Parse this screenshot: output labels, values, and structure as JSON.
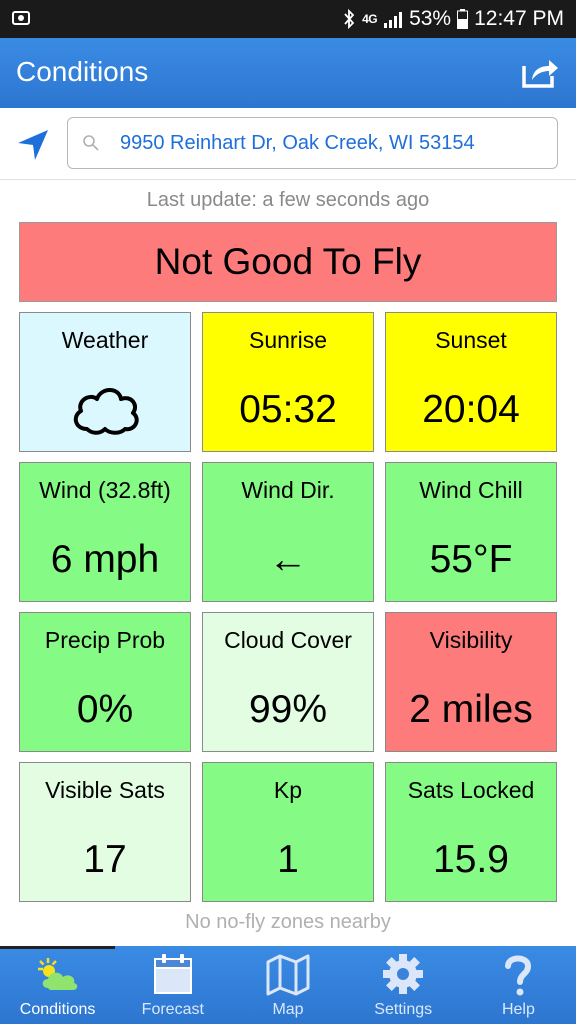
{
  "status_bar": {
    "network": "4G",
    "battery": "53%",
    "time": "12:47 PM"
  },
  "app_bar": {
    "title": "Conditions"
  },
  "search": {
    "address": "9950 Reinhart Dr, Oak Creek, WI 53154"
  },
  "last_update": "Last update: a few seconds ago",
  "verdict": "Not Good To Fly",
  "tiles": [
    {
      "label": "Weather",
      "value": "",
      "icon": "cloud-icon",
      "color": "#dcf8ff"
    },
    {
      "label": "Sunrise",
      "value": "05:32",
      "color": "#ffff00"
    },
    {
      "label": "Sunset",
      "value": "20:04",
      "color": "#ffff00"
    },
    {
      "label": "Wind (32.8ft)",
      "value": "6 mph",
      "color": "#85fb85"
    },
    {
      "label": "Wind Dir.",
      "value": "←",
      "color": "#85fb85"
    },
    {
      "label": "Wind Chill",
      "value": "55°F",
      "color": "#85fb85"
    },
    {
      "label": "Precip Prob",
      "value": "0%",
      "color": "#85fb85"
    },
    {
      "label": "Cloud Cover",
      "value": "99%",
      "color": "#e2fde2"
    },
    {
      "label": "Visibility",
      "value": "2 miles",
      "color": "#fd7b7b"
    },
    {
      "label": "Visible Sats",
      "value": "17",
      "color": "#e2fde2"
    },
    {
      "label": "Kp",
      "value": "1",
      "color": "#85fb85"
    },
    {
      "label": "Sats Locked",
      "value": "15.9",
      "color": "#85fb85"
    }
  ],
  "no_fly_note": "No no-fly zones nearby",
  "nav": [
    {
      "label": "Conditions",
      "icon": "weather-icon",
      "active": true
    },
    {
      "label": "Forecast",
      "icon": "calendar-icon",
      "active": false
    },
    {
      "label": "Map",
      "icon": "map-icon",
      "active": false
    },
    {
      "label": "Settings",
      "icon": "gear-icon",
      "active": false
    },
    {
      "label": "Help",
      "icon": "help-icon",
      "active": false
    }
  ],
  "colors": {
    "app_bar": "#2d76d0",
    "not_good": "#fd7b7b",
    "good": "#85fb85",
    "caution_yellow": "#ffff00"
  }
}
